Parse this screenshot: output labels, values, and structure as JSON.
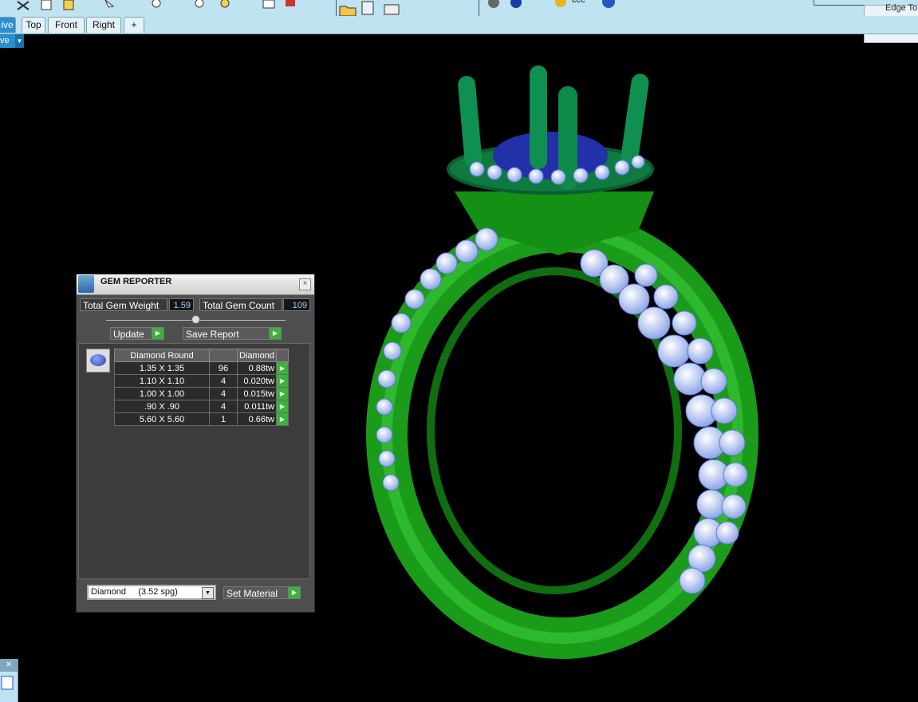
{
  "viewport_tabs": [
    {
      "label": "ive",
      "active": true
    },
    {
      "label": "Top",
      "active": false
    },
    {
      "label": "Front",
      "active": false
    },
    {
      "label": "Right",
      "active": false
    },
    {
      "label": "+",
      "active": false
    }
  ],
  "view_dropdown": {
    "label": "ve"
  },
  "toolbar_snippets": {
    "edge_tool_label": "Edge To",
    "ccc_label": "ccc"
  },
  "gem_reporter": {
    "title": "GEM REPORTER",
    "close_label": "×",
    "total_weight_label": "Total Gem Weight",
    "total_weight_value": "1.59",
    "total_count_label": "Total Gem Count",
    "total_count_value": "109",
    "update_label": "Update",
    "save_report_label": "Save Report",
    "table": {
      "headers": [
        "Diamond Round",
        "",
        "Diamond"
      ],
      "rows": [
        {
          "size": "1.35 X 1.35",
          "count": "96",
          "weight": "0.88tw"
        },
        {
          "size": "1.10 X 1.10",
          "count": "4",
          "weight": "0.020tw"
        },
        {
          "size": "1.00 X 1.00",
          "count": "4",
          "weight": "0.015tw"
        },
        {
          "size": ".90 X .90",
          "count": "4",
          "weight": "0.011tw"
        },
        {
          "size": "5.60 X 5.60",
          "count": "1",
          "weight": "0.66tw"
        }
      ]
    },
    "material_value": "Diamond     (3.52 spg)",
    "set_material_label": "Set Material"
  },
  "colors": {
    "ring_green": "#1ea81e",
    "gem_blue": "#2233aa",
    "diamond": "#c8d8ff",
    "tab_active": "#2b8fd0"
  }
}
